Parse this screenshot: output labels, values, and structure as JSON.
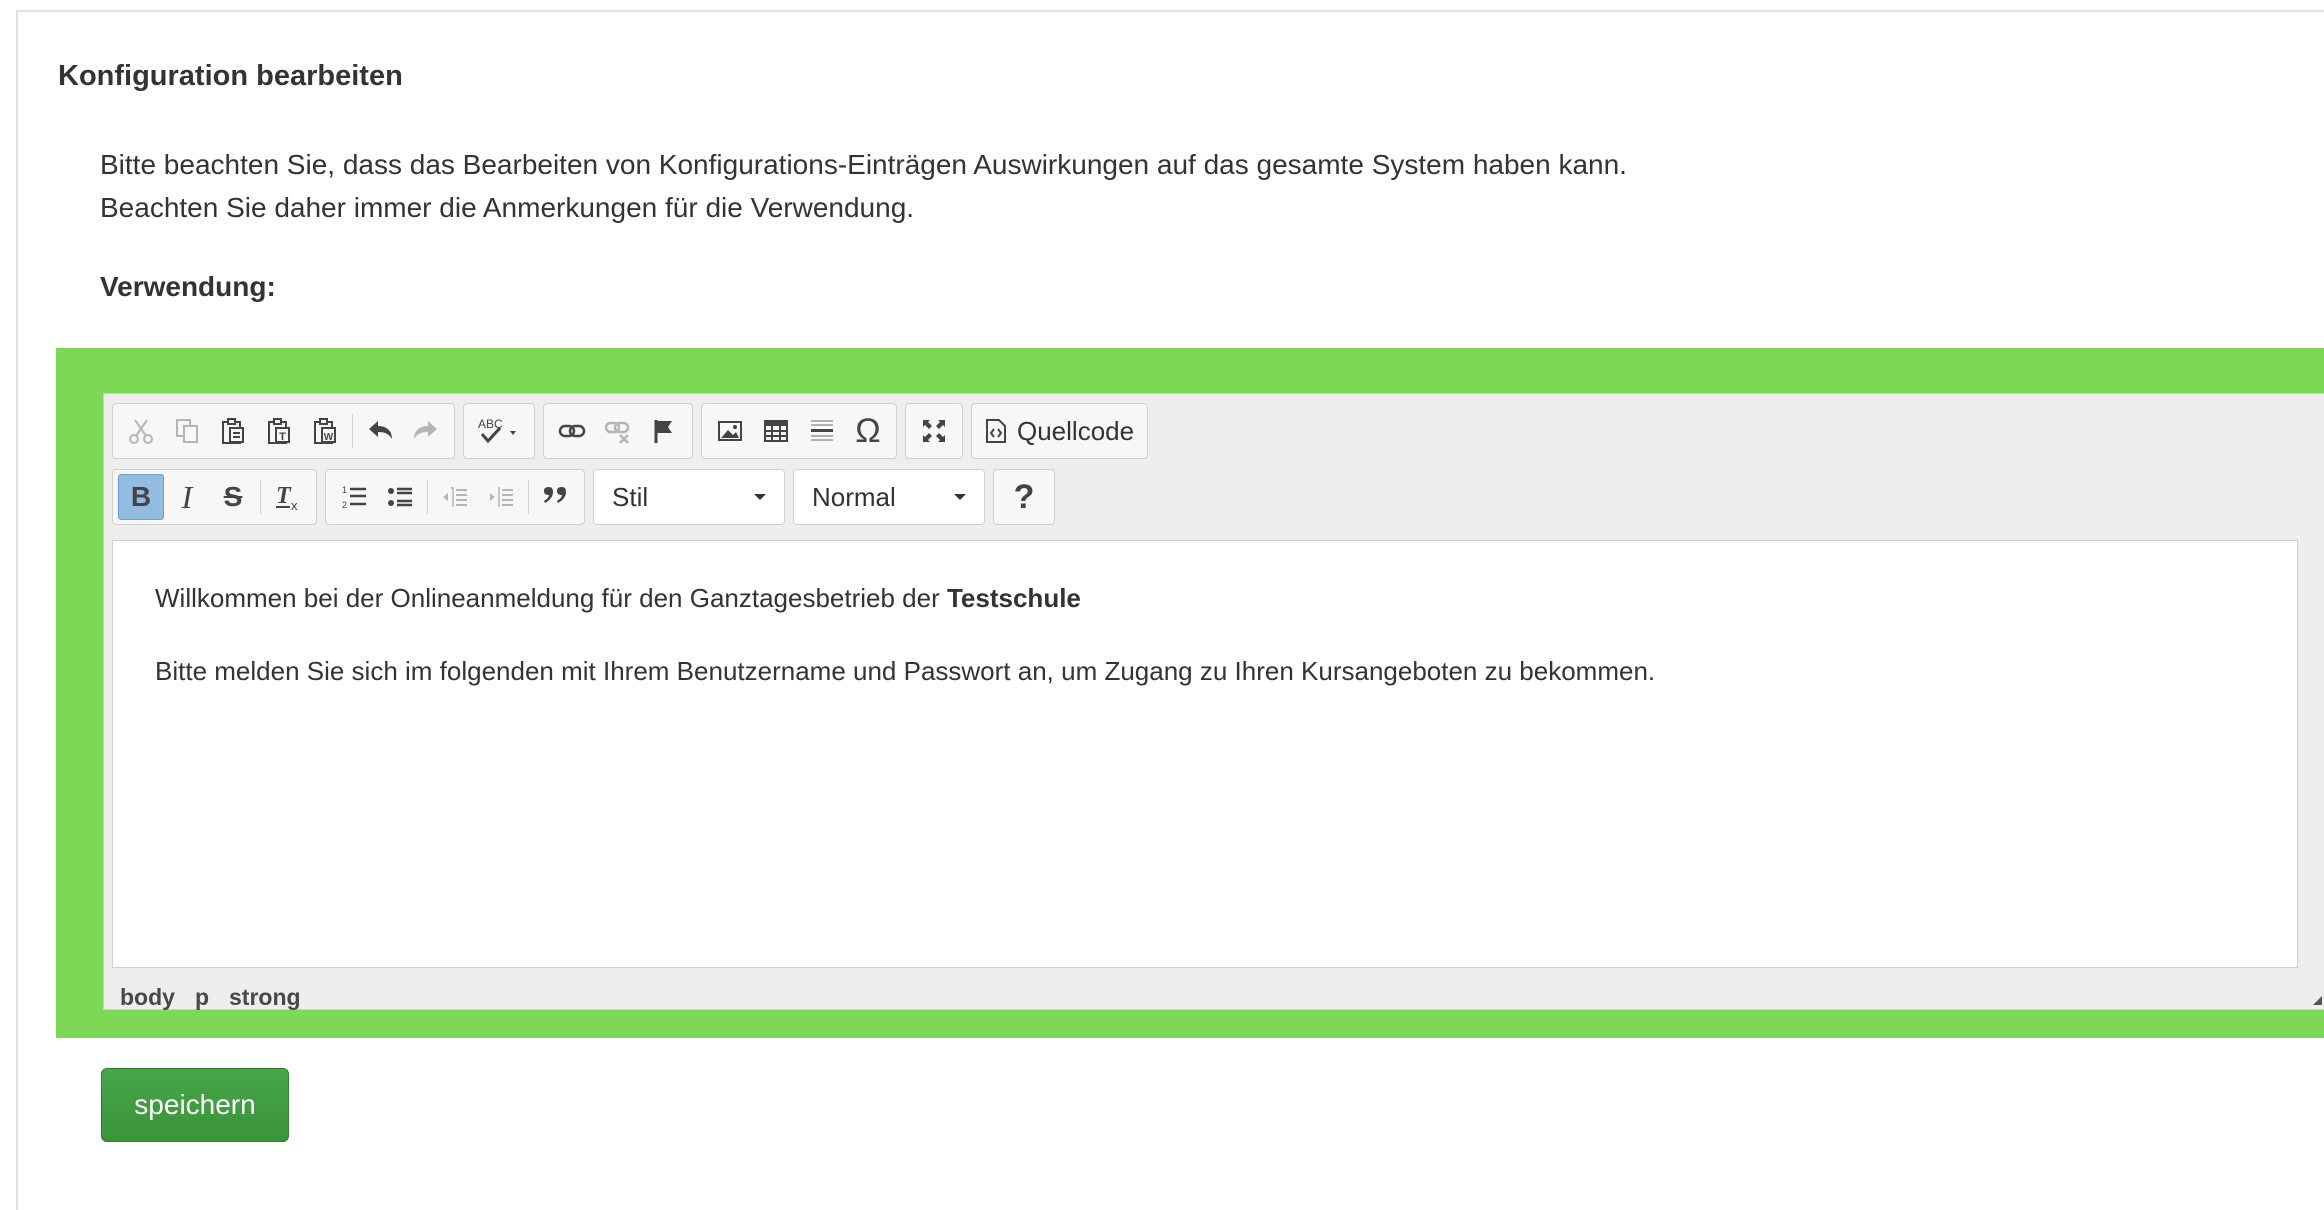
{
  "page": {
    "title": "Konfiguration bearbeiten",
    "info_line1": "Bitte beachten Sie, dass das Bearbeiten von Konfigurations-Einträgen Auswirkungen auf das gesamte System haben kann.",
    "info_line2": "Beachten Sie daher immer die Anmerkungen für die Verwendung.",
    "usage_label": "Verwendung:"
  },
  "editor": {
    "toolbar_row1": [
      {
        "group": "clipboard",
        "icons": [
          "cut-icon",
          "copy-icon",
          "paste-icon",
          "paste-text-icon",
          "paste-word-icon",
          "undo-icon",
          "redo-icon"
        ]
      },
      {
        "group": "spellcheck",
        "icons": [
          "spellcheck-icon"
        ]
      },
      {
        "group": "links",
        "icons": [
          "link-icon",
          "unlink-icon",
          "anchor-icon"
        ]
      },
      {
        "group": "insert",
        "icons": [
          "image-icon",
          "table-icon",
          "horizontal-line-icon",
          "special-char-icon"
        ]
      },
      {
        "group": "tools",
        "icons": [
          "maximize-icon"
        ]
      },
      {
        "group": "document",
        "icons": [
          "source-icon"
        ]
      }
    ],
    "source_label": "Quellcode",
    "toolbar_row2": [
      {
        "group": "basicstyles",
        "icons": [
          "bold-icon",
          "italic-icon",
          "strike-icon",
          "remove-format-icon"
        ]
      },
      {
        "group": "paragraph",
        "icons": [
          "numbered-list-icon",
          "bulleted-list-icon",
          "outdent-icon",
          "indent-icon",
          "blockquote-icon"
        ]
      }
    ],
    "style_combo": "Stil",
    "format_combo": "Normal",
    "help_label": "?",
    "content": {
      "p1_text": "Willkommen bei der Onlineanmeldung für den Ganztagesbetrieb der ",
      "p1_bold": "Testschule",
      "p2_text": "Bitte melden Sie sich im folgenden mit Ihrem Benutzername und Passwort an, um Zugang zu Ihren Kursangeboten zu bekommen."
    },
    "elements_path": [
      "body",
      "p",
      "strong"
    ]
  },
  "actions": {
    "save_label": "speichern"
  },
  "colors": {
    "highlight": "#7dd856",
    "save_button": "#40a040",
    "active_button": "#92bce0"
  }
}
